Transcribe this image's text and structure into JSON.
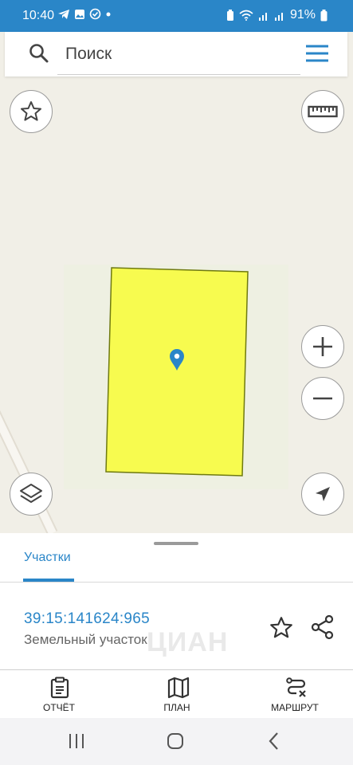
{
  "status_bar": {
    "time": "10:40",
    "battery": "91%"
  },
  "search": {
    "placeholder": "Поиск"
  },
  "map": {
    "parcel_fill_color": "#f7fb4f",
    "parcel_stroke_color": "#6f7a10",
    "pin_color": "#2a86c8"
  },
  "panel": {
    "tab_label": "Участки",
    "parcel": {
      "number": "39:15:141624:965",
      "type": "Земельный участок"
    },
    "watermark": "ЦИАН"
  },
  "actions": [
    {
      "label": "ОТЧЁТ",
      "icon": "report-icon"
    },
    {
      "label": "ПЛАН",
      "icon": "map-plan-icon"
    },
    {
      "label": "МАРШРУТ",
      "icon": "route-icon"
    }
  ],
  "colors": {
    "accent": "#2a86c8"
  }
}
